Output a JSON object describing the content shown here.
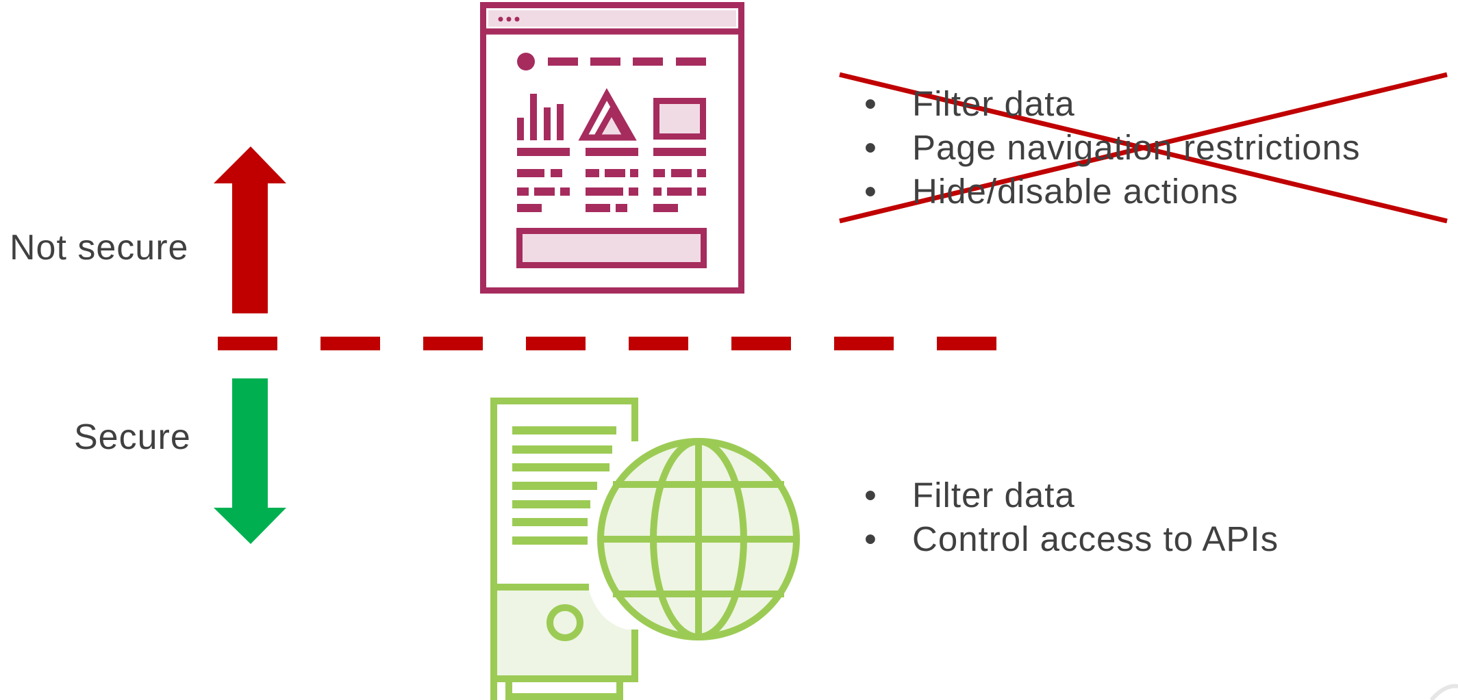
{
  "labels": {
    "not_secure": "Not secure",
    "secure": "Secure"
  },
  "client_side": {
    "icon": "web-page-icon",
    "crossed_out": true,
    "bullets": [
      "Filter data",
      "Page navigation restrictions",
      "Hide/disable actions"
    ]
  },
  "server_side": {
    "icon": "server-globe-icon",
    "bullets": [
      "Filter data",
      "Control access to APIs"
    ]
  },
  "colors": {
    "insecure": "#c00000",
    "secure": "#00b050",
    "client_icon": "#a62c5e",
    "client_icon_fill": "#f0dbe4",
    "server_icon": "#9ccb55",
    "server_icon_fill": "#eef5e4",
    "text": "#404040"
  }
}
